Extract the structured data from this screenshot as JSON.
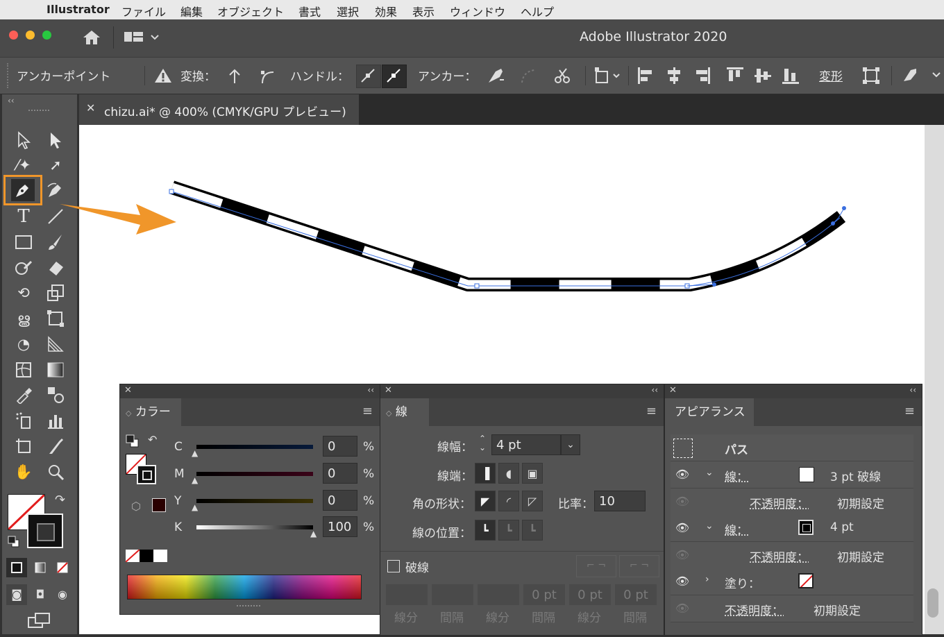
{
  "menubar": {
    "app": "Illustrator",
    "items": [
      "ファイル",
      "編集",
      "オブジェクト",
      "書式",
      "選択",
      "効果",
      "表示",
      "ウィンドウ",
      "ヘルプ"
    ]
  },
  "titlebar": {
    "title": "Adobe Illustrator 2020"
  },
  "control": {
    "label": "アンカーポイント",
    "convert": "変換：",
    "handles": "ハンドル：",
    "anchors": "アンカー：",
    "transform": "変形"
  },
  "document": {
    "tab": "chizu.ai* @ 400% (CMYK/GPU プレビュー)"
  },
  "color_panel": {
    "title": "カラー",
    "channels": [
      {
        "label": "C",
        "value": "0",
        "unit": "%"
      },
      {
        "label": "M",
        "value": "0",
        "unit": "%"
      },
      {
        "label": "Y",
        "value": "0",
        "unit": "%"
      },
      {
        "label": "K",
        "value": "100",
        "unit": "%"
      }
    ]
  },
  "stroke_panel": {
    "title": "線",
    "weight_label": "線幅：",
    "weight_value": "4 pt",
    "cap_label": "線端：",
    "corner_label": "角の形状：",
    "ratio_label": "比率：",
    "ratio_value": "10",
    "align_label": "線の位置：",
    "dashed_label": "破線",
    "dash_fields": [
      "",
      "",
      "",
      "0 pt",
      "0 pt",
      "0 pt"
    ],
    "dash_labels": [
      "線分",
      "間隔",
      "線分",
      "間隔",
      "線分",
      "間隔"
    ]
  },
  "appearance_panel": {
    "title": "アピアランス",
    "object": "パス",
    "rows": [
      {
        "label": "線：",
        "value": "3 pt 破線"
      },
      {
        "label": "不透明度：",
        "value": "初期設定"
      },
      {
        "label": "線：",
        "value": "4 pt"
      },
      {
        "label": "不透明度：",
        "value": "初期設定"
      },
      {
        "label": "塗り：",
        "value": ""
      },
      {
        "label": "不透明度：",
        "value": "初期設定"
      }
    ]
  },
  "colors": {
    "accent_orange": "#f0962a",
    "path_blue": "#3a6fe0"
  }
}
